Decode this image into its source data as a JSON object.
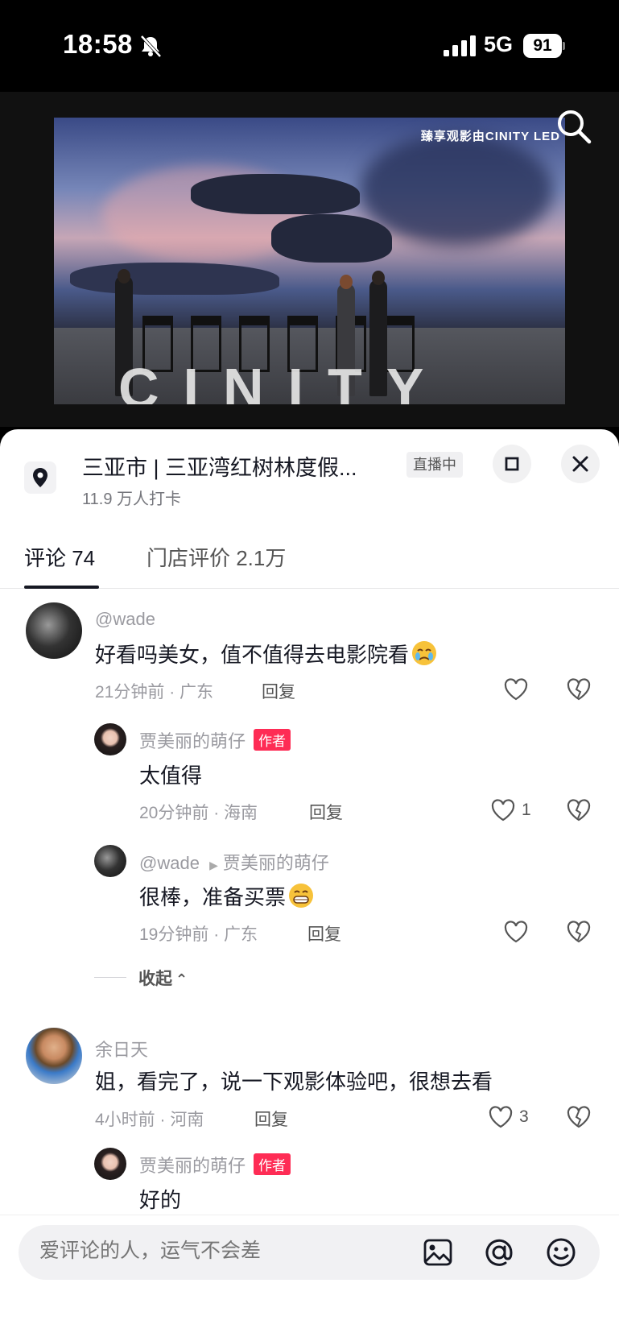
{
  "status": {
    "time": "18:58",
    "network": "5G",
    "battery": "91"
  },
  "video": {
    "brand_text": "臻享观影由CINITY LED",
    "stage_text": "CINITY"
  },
  "location": {
    "title": "三亚市 | 三亚湾红树林度假...",
    "checkins": "11.9 万人打卡",
    "live_badge": "直播中"
  },
  "tabs": [
    {
      "label": "评论 74"
    },
    {
      "label": "门店评价 2.1万"
    }
  ],
  "comments": [
    {
      "user": "@wade",
      "text": "好看吗美女，值不值得去电影院看",
      "emoji": "crying-face",
      "time_loc": "21分钟前 · 广东",
      "reply": "回复",
      "likes": ""
    },
    {
      "user": "贾美丽的萌仔",
      "badge": "作者",
      "text": "太值得",
      "time_loc": "20分钟前 · 海南",
      "reply": "回复",
      "likes": "1"
    },
    {
      "user": "@wade",
      "reply_to": "贾美丽的萌仔",
      "text": "很棒，准备买票",
      "emoji": "grinning-face",
      "time_loc": "19分钟前 · 广东",
      "reply": "回复",
      "likes": ""
    },
    {
      "user": "余日天",
      "text": "姐，看完了，说一下观影体验吧，很想去看",
      "time_loc": "4小时前 · 河南",
      "reply": "回复",
      "likes": "3"
    },
    {
      "user": "贾美丽的萌仔",
      "badge": "作者",
      "text": "好的"
    }
  ],
  "collapse_label": "收起",
  "input": {
    "placeholder": "爱评论的人，运气不会差"
  },
  "colors": {
    "accent": "#fe2c55",
    "text": "#161823",
    "muted": "#9a9aa0"
  }
}
